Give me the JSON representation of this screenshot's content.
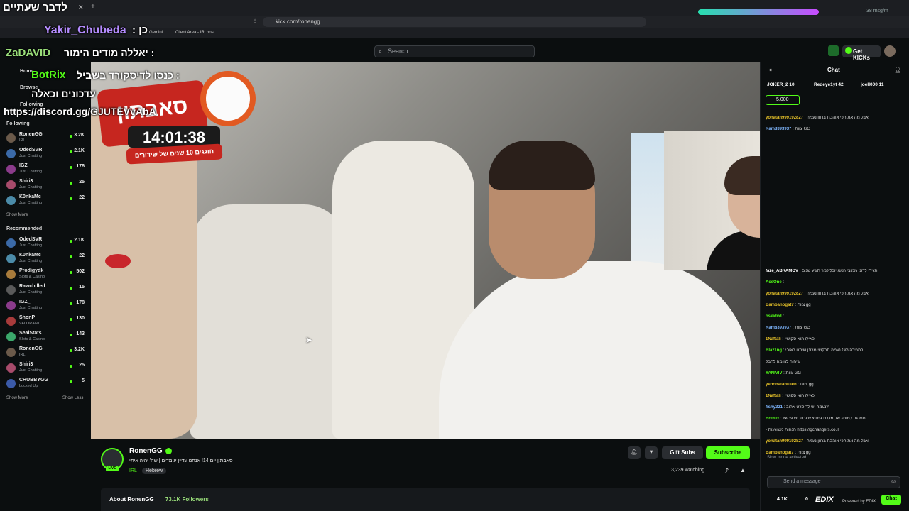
{
  "browser": {
    "url": "kick.com/ronengg",
    "bookmark": "Client Area - IRLhos...",
    "bookmark_gemini": "Gemini",
    "extension_rate": "38 msg/m"
  },
  "header": {
    "search_placeholder": "Search",
    "get_kicks": "Get KICKs"
  },
  "overlay": {
    "tab_title": "לדבר שעתיים",
    "line1_user": "Yakir_Chubeda",
    "line1_text": ": כן",
    "line2_user": "ZaDAVID",
    "line2_text": "יאללה מודים הימור :",
    "line3_user": "BotRix",
    "line3_text": "כנסו לדיסקורד בשביל :",
    "line4_text": "עדכונים וכאלה",
    "line5_text": "https://discord.gg/GJUTEVvAbA",
    "sign_text": "סאבתון",
    "timer": "14:01:38",
    "timer_sub": "חוגגים 10 שנים של שידורים"
  },
  "sidebar": {
    "nav": [
      "Home",
      "Browse",
      "Following"
    ],
    "following_heading": "Following",
    "following": [
      {
        "name": "RonenGG",
        "cat": "IRL",
        "count": "3.2K",
        "color": "#6b5a4a"
      },
      {
        "name": "OdedSVR",
        "cat": "Just Chatting",
        "count": "2.1K",
        "color": "#3b6aa8"
      },
      {
        "name": "IGZ_",
        "cat": "Just Chatting",
        "count": "176",
        "color": "#8b3b8b"
      },
      {
        "name": "Shiri3",
        "cat": "Just Chatting",
        "count": "25",
        "color": "#a84b6b"
      },
      {
        "name": "K0nkaMc",
        "cat": "Just Chatting",
        "count": "22",
        "color": "#4b8ba8"
      }
    ],
    "show_more_1": "Show More",
    "recommended_heading": "Recommended",
    "recommended": [
      {
        "name": "OdedSVR",
        "cat": "Just Chatting",
        "count": "2.1K",
        "color": "#3b6aa8"
      },
      {
        "name": "K0nkaMc",
        "cat": "Just Chatting",
        "count": "22",
        "color": "#4b8ba8"
      },
      {
        "name": "Prodigydk",
        "cat": "Slots & Casino",
        "count": "502",
        "color": "#a87b3b"
      },
      {
        "name": "Rawchilled",
        "cat": "Just Chatting",
        "count": "15",
        "color": "#5a5a5a"
      },
      {
        "name": "IGZ_",
        "cat": "Just Chatting",
        "count": "178",
        "color": "#8b3b8b"
      },
      {
        "name": "ShonP",
        "cat": "VALORANT",
        "count": "130",
        "color": "#a83b3b"
      },
      {
        "name": "SealStats",
        "cat": "Slots & Casino",
        "count": "143",
        "color": "#3ba86b"
      },
      {
        "name": "RonenGG",
        "cat": "IRL",
        "count": "3.2K",
        "color": "#6b5a4a"
      },
      {
        "name": "Shiri3",
        "cat": "Just Chatting",
        "count": "25",
        "color": "#a84b6b"
      },
      {
        "name": "CHUBBYGG",
        "cat": "Locked Up",
        "count": "5",
        "color": "#3b5aa8"
      }
    ],
    "show_more_2": "Show More",
    "show_less": "Show Less"
  },
  "stream": {
    "streamer": "RonenGG",
    "title": "סאבתון יום 14! אנחנו עדיין עומדים | שה' יהיה איתי",
    "category": "IRL",
    "language": "Hebrew",
    "gift_subs": "Gift Subs",
    "subscribe": "Subscribe",
    "watching": "3,239 watching",
    "about": "About RonenGG",
    "followers": "73.1K Followers",
    "live": "LIVE"
  },
  "chat": {
    "title": "Chat",
    "top_gifters": [
      {
        "name": "JOKER_2",
        "count": "10"
      },
      {
        "name": "Redeye1yt",
        "count": "42"
      },
      {
        "name": "joell000",
        "count": "11"
      }
    ],
    "pinned_amount": "5,000",
    "messages": [
      {
        "user": "yonatan999192827",
        "color": "#e6c229",
        "text": ": אבל מה את הכי אוהבת ברוון נעמה"
      },
      {
        "user": "Ram8393937",
        "color": "#7fb7ff",
        "text": ": צוות GG"
      },
      {
        "user": "faze_ABRAMOV",
        "color": "#ffffff",
        "text": ": תגידי לרונן ממוצי האא יוכל למר תשע שנים"
      },
      {
        "user": "AceOne",
        "color": "#53fc18",
        "text": ":"
      },
      {
        "user": "yonatan999192827",
        "color": "#e6c229",
        "text": ": אבל מה את הכי אוהבת ברוון נעמה"
      },
      {
        "user": "Bambanogat7",
        "color": "#e6c229",
        "text": ": צוות gg"
      },
      {
        "user": "oskidvd",
        "color": "#53fc18",
        "text": ":"
      },
      {
        "user": "Ram8393937",
        "color": "#7fb7ff",
        "text": ": צוות GG"
      },
      {
        "user": "1Naftali",
        "color": "#e6c229",
        "text": ": כאילו הוא סקושיי"
      },
      {
        "user": "Blaz1ng",
        "color": "#53fc18",
        "text": ": נעמה תבקשי מרונן שיתנו ראובי GG למכירה"
      },
      {
        "user": "",
        "color": "#dcdcdc",
        "text": "שיהיה לנו מה לחבק"
      },
      {
        "user": "YANIVIV",
        "color": "#53fc18",
        "text": ": צוות GG"
      },
      {
        "user": "yehonatanklien",
        "color": "#e6c229",
        "text": ": צוות gg"
      },
      {
        "user": "1Naftali",
        "color": "#e6c229",
        "text": ": כאילו הוא סקושיי"
      },
      {
        "user": "fishy321",
        "color": "#7fb7ff",
        "text": ": נעמה יש לך סרט אהוב?"
      },
      {
        "user": "BotRix",
        "color": "#53fc18",
        "text": ": תפרגנו למותג של מלכם ג'ים צ'יינגרס, יש עכשיו"
      },
      {
        "user": "",
        "color": "#dcdcdc",
        "text": "- הנחות משוגעות https://gchangers.co.il"
      },
      {
        "user": "yonatan999192827",
        "color": "#e6c229",
        "text": ": אבל מה את הכי אוהבת ברוון נעמה"
      },
      {
        "user": "Bambanogat7",
        "color": "#e6c229",
        "text": ": צוות gg"
      }
    ],
    "slow_mode": "Slow mode activated",
    "input_placeholder": "Send a message",
    "kicks": "4.1K",
    "zero": "0",
    "powered": "Powered by EDIX",
    "edix": "EDIX",
    "send": "Chat"
  }
}
